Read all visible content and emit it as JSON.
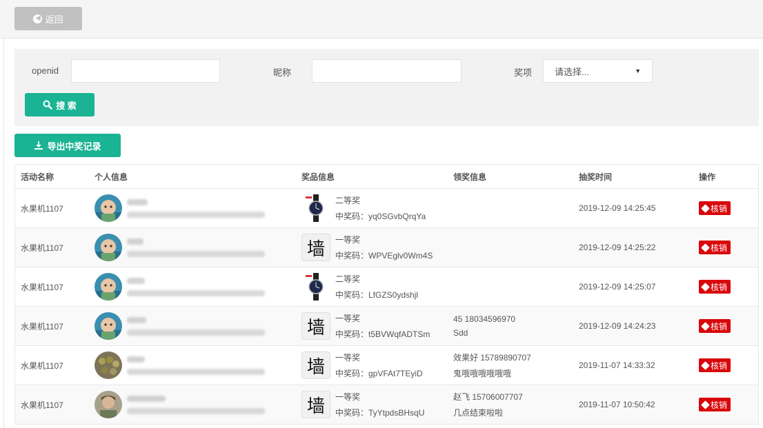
{
  "topbar": {
    "back_label": "返回"
  },
  "filter": {
    "openid_label": "openid",
    "nickname_label": "昵称",
    "prize_label": "奖项",
    "prize_select_value": "请选择...",
    "search_label": "搜 索"
  },
  "export_label": "导出中奖记录",
  "table": {
    "headers": [
      "活动名称",
      "个人信息",
      "奖品信息",
      "领奖信息",
      "抽奖时间",
      "操作"
    ],
    "rows": [
      {
        "activity": "水果机1107",
        "prize_image": "watch",
        "prize": "二等奖",
        "code": "中奖码：yq0SGvbQrqYa",
        "claim_line1": "",
        "claim_line2": "",
        "time": "2019-12-09 14:25:45",
        "action": "核销",
        "avatar": "baby"
      },
      {
        "activity": "水果机1107",
        "prize_image": "wall",
        "prize": "一等奖",
        "code": "中奖码：WPVEglv0Wm4S",
        "claim_line1": "",
        "claim_line2": "",
        "time": "2019-12-09 14:25:22",
        "action": "核销",
        "avatar": "baby"
      },
      {
        "activity": "水果机1107",
        "prize_image": "watch",
        "prize": "二等奖",
        "code": "中奖码：LfGZS0ydshjl",
        "claim_line1": "",
        "claim_line2": "",
        "time": "2019-12-09 14:25:07",
        "action": "核销",
        "avatar": "baby"
      },
      {
        "activity": "水果机1107",
        "prize_image": "wall",
        "prize": "一等奖",
        "code": "中奖码：t5BVWqfADTSm",
        "claim_line1": "45   18034596970",
        "claim_line2": "Sdd",
        "time": "2019-12-09 14:24:23",
        "action": "核销",
        "avatar": "baby"
      },
      {
        "activity": "水果机1107",
        "prize_image": "wall",
        "prize": "一等奖",
        "code": "中奖码：gpVFAt7TEyiD",
        "claim_line1": "效果好   15789890707",
        "claim_line2": "鬼哦哦哦哦哦哦",
        "time": "2019-11-07 14:33:32",
        "action": "核销",
        "avatar": "food"
      },
      {
        "activity": "水果机1107",
        "prize_image": "wall",
        "prize": "一等奖",
        "code": "中奖码：TyYtpdsBHsqU",
        "claim_line1": "赵飞   15706007707",
        "claim_line2": "几点结束啦啦",
        "time": "2019-11-07 10:50:42",
        "action": "核销",
        "avatar": "person"
      }
    ]
  },
  "prize_wall_glyph": "墙",
  "colors": {
    "primary": "#1ab394",
    "danger": "#d9060a",
    "back_button": "#c1c1c1"
  }
}
